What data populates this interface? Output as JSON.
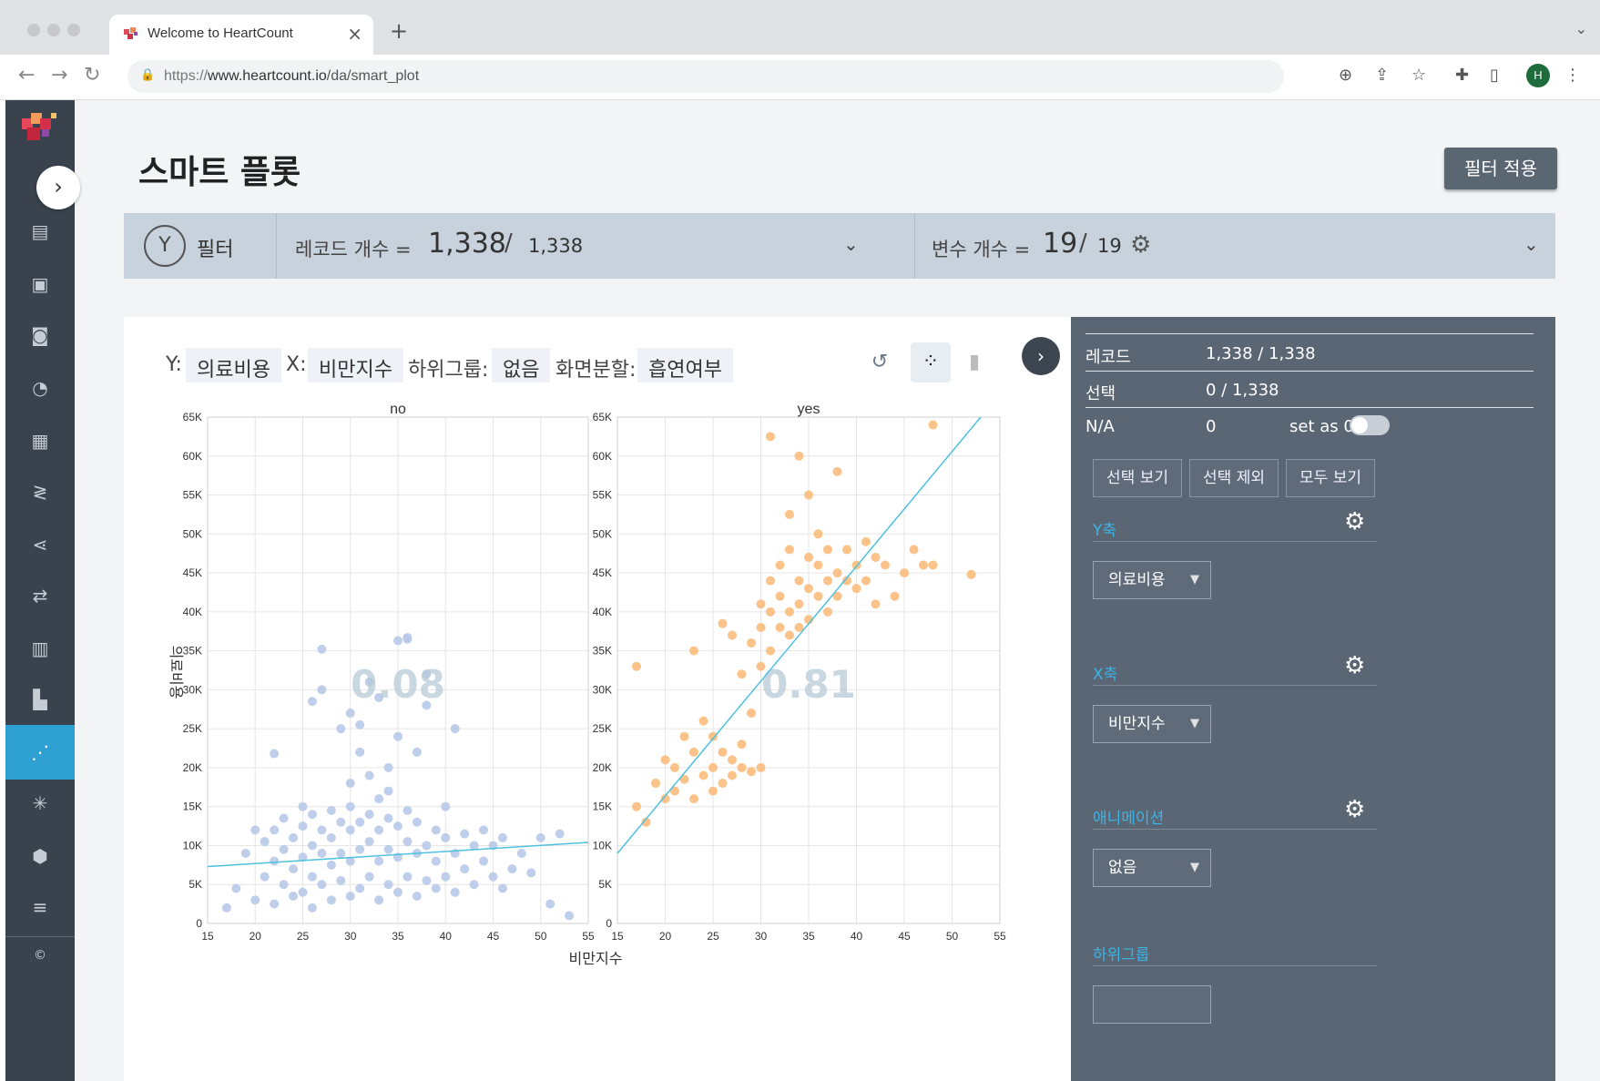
{
  "browser": {
    "tab_title": "Welcome to HeartCount",
    "new_tab": "+",
    "url_scheme": "https://",
    "url_host": "www.heartcount.io",
    "url_path": "/da/smart_plot",
    "profile_initial": "H"
  },
  "header": {
    "title": "스마트 플롯",
    "apply_button": "필터 적용"
  },
  "filterbar": {
    "filter_label": "필터",
    "record_label": "레코드 개수 =",
    "record_count": "1,338",
    "record_total": "1,338",
    "variable_label": "변수 개수 =",
    "variable_count": "19",
    "variable_total": "19",
    "slash": "/"
  },
  "axes_bar": {
    "y_key": "Y:",
    "y_value": "의료비용",
    "x_key": "X:",
    "x_value": "비만지수",
    "subgroup_key": "하위그룹:",
    "subgroup_value": "없음",
    "split_key": "화면분할:",
    "split_value": "흡연여부"
  },
  "panel": {
    "rows": [
      {
        "key": "레코드",
        "value": "1,338 / 1,338"
      },
      {
        "key": "선택",
        "value": "0 / 1,338"
      },
      {
        "key": "N/A",
        "value": "0",
        "setas": "set as 0"
      }
    ],
    "buttons": [
      "선택 보기",
      "선택 제외",
      "모두 보기"
    ],
    "sections": [
      {
        "title": "Y축",
        "value": "의료비용"
      },
      {
        "title": "X축",
        "value": "비만지수"
      },
      {
        "title": "애니메이션",
        "value": "없음"
      },
      {
        "title": "하위그룹",
        "value": ""
      }
    ]
  },
  "colors": {
    "no_points": "#b8c9e8",
    "yes_points": "#fbbb7c",
    "trend_line": "#4fc1e0",
    "panel_bg": "#5a6674",
    "sidebar_bg": "#39424d",
    "accent": "#2fa0d2"
  },
  "chart_data": {
    "type": "scatter",
    "xlabel": "비만지수",
    "ylabel": "의료비용",
    "xlim": [
      15,
      55
    ],
    "ylim": [
      0,
      65000
    ],
    "x_ticks": [
      "15",
      "20",
      "25",
      "30",
      "35",
      "40",
      "45",
      "50",
      "55"
    ],
    "y_ticks": [
      "0",
      "5K",
      "10K",
      "15K",
      "20K",
      "25K",
      "30K",
      "35K",
      "40K",
      "45K",
      "50K",
      "55K",
      "60K",
      "65K"
    ],
    "panels": [
      {
        "name": "no",
        "correlation": "0.08",
        "trend": [
          [
            15,
            7300
          ],
          [
            55,
            10400
          ]
        ],
        "points": [
          [
            18,
            4500
          ],
          [
            19,
            9000
          ],
          [
            20,
            12000
          ],
          [
            20,
            3000
          ],
          [
            21,
            6000
          ],
          [
            21,
            10500
          ],
          [
            22,
            2500
          ],
          [
            22,
            8000
          ],
          [
            22,
            12000
          ],
          [
            23,
            5000
          ],
          [
            23,
            9500
          ],
          [
            23,
            13500
          ],
          [
            24,
            3500
          ],
          [
            24,
            7000
          ],
          [
            24,
            11000
          ],
          [
            25,
            4000
          ],
          [
            25,
            8500
          ],
          [
            25,
            12500
          ],
          [
            25,
            15000
          ],
          [
            26,
            2000
          ],
          [
            26,
            6000
          ],
          [
            26,
            10000
          ],
          [
            26,
            14000
          ],
          [
            27,
            5000
          ],
          [
            27,
            9000
          ],
          [
            27,
            12000
          ],
          [
            27,
            30000
          ],
          [
            28,
            3000
          ],
          [
            28,
            7500
          ],
          [
            28,
            11000
          ],
          [
            28,
            14500
          ],
          [
            29,
            5500
          ],
          [
            29,
            9000
          ],
          [
            29,
            13000
          ],
          [
            29,
            25000
          ],
          [
            30,
            3500
          ],
          [
            30,
            8000
          ],
          [
            30,
            12000
          ],
          [
            30,
            15000
          ],
          [
            30,
            27000
          ],
          [
            31,
            4500
          ],
          [
            31,
            9500
          ],
          [
            31,
            13000
          ],
          [
            31,
            22000
          ],
          [
            32,
            6000
          ],
          [
            32,
            10500
          ],
          [
            32,
            14000
          ],
          [
            32,
            19000
          ],
          [
            33,
            3000
          ],
          [
            33,
            8000
          ],
          [
            33,
            12000
          ],
          [
            33,
            16000
          ],
          [
            33,
            29000
          ],
          [
            34,
            5000
          ],
          [
            34,
            9500
          ],
          [
            34,
            13500
          ],
          [
            34,
            20000
          ],
          [
            35,
            4000
          ],
          [
            35,
            8500
          ],
          [
            35,
            12500
          ],
          [
            35,
            24000
          ],
          [
            36,
            6000
          ],
          [
            36,
            10500
          ],
          [
            36,
            14500
          ],
          [
            36,
            36500
          ],
          [
            37,
            3500
          ],
          [
            37,
            9000
          ],
          [
            37,
            13000
          ],
          [
            37,
            22000
          ],
          [
            38,
            5500
          ],
          [
            38,
            10000
          ],
          [
            38,
            28000
          ],
          [
            39,
            4500
          ],
          [
            39,
            8000
          ],
          [
            39,
            12000
          ],
          [
            40,
            6000
          ],
          [
            40,
            11000
          ],
          [
            40,
            15000
          ],
          [
            41,
            4000
          ],
          [
            41,
            9000
          ],
          [
            41,
            25000
          ],
          [
            42,
            7000
          ],
          [
            42,
            11500
          ],
          [
            43,
            5000
          ],
          [
            43,
            10000
          ],
          [
            44,
            8000
          ],
          [
            44,
            12000
          ],
          [
            45,
            6000
          ],
          [
            45,
            10000
          ],
          [
            46,
            4500
          ],
          [
            46,
            11000
          ],
          [
            47,
            7000
          ],
          [
            48,
            9000
          ],
          [
            49,
            6500
          ],
          [
            50,
            11000
          ],
          [
            51,
            2500
          ],
          [
            52,
            11500
          ],
          [
            53,
            1000
          ],
          [
            27,
            35200
          ],
          [
            35,
            36300
          ],
          [
            36,
            36700
          ],
          [
            22,
            21800
          ],
          [
            17,
            2000
          ],
          [
            26,
            28500
          ],
          [
            30,
            18000
          ],
          [
            32,
            31000
          ],
          [
            38,
            32000
          ],
          [
            31,
            25500
          ],
          [
            34,
            17000
          ]
        ]
      },
      {
        "name": "yes",
        "correlation": "0.81",
        "trend": [
          [
            15,
            9000
          ],
          [
            53,
            65000
          ]
        ],
        "points": [
          [
            17,
            33000
          ],
          [
            17,
            15000
          ],
          [
            18,
            13000
          ],
          [
            19,
            18000
          ],
          [
            20,
            16000
          ],
          [
            20,
            21000
          ],
          [
            21,
            20000
          ],
          [
            21,
            17000
          ],
          [
            22,
            18500
          ],
          [
            22,
            24000
          ],
          [
            23,
            35000
          ],
          [
            23,
            22000
          ],
          [
            23,
            16000
          ],
          [
            24,
            26000
          ],
          [
            24,
            19000
          ],
          [
            25,
            24000
          ],
          [
            25,
            20000
          ],
          [
            25,
            17000
          ],
          [
            26,
            22000
          ],
          [
            26,
            18000
          ],
          [
            26,
            38500
          ],
          [
            27,
            21000
          ],
          [
            27,
            19000
          ],
          [
            27,
            37000
          ],
          [
            28,
            23000
          ],
          [
            28,
            20000
          ],
          [
            28,
            32000
          ],
          [
            29,
            19500
          ],
          [
            29,
            27000
          ],
          [
            29,
            36000
          ],
          [
            30,
            20000
          ],
          [
            30,
            33000
          ],
          [
            30,
            38000
          ],
          [
            30,
            41000
          ],
          [
            31,
            35000
          ],
          [
            31,
            40000
          ],
          [
            31,
            44000
          ],
          [
            31,
            62500
          ],
          [
            32,
            38000
          ],
          [
            32,
            42000
          ],
          [
            32,
            46000
          ],
          [
            33,
            40000
          ],
          [
            33,
            37000
          ],
          [
            33,
            48000
          ],
          [
            33,
            52500
          ],
          [
            34,
            41000
          ],
          [
            34,
            44000
          ],
          [
            34,
            38000
          ],
          [
            34,
            60000
          ],
          [
            35,
            43000
          ],
          [
            35,
            39000
          ],
          [
            35,
            47000
          ],
          [
            35,
            55000
          ],
          [
            36,
            42000
          ],
          [
            36,
            46000
          ],
          [
            36,
            50000
          ],
          [
            37,
            40000
          ],
          [
            37,
            44000
          ],
          [
            37,
            48000
          ],
          [
            38,
            45000
          ],
          [
            38,
            42000
          ],
          [
            38,
            58000
          ],
          [
            39,
            44000
          ],
          [
            39,
            48000
          ],
          [
            40,
            46000
          ],
          [
            40,
            43000
          ],
          [
            41,
            49000
          ],
          [
            41,
            44000
          ],
          [
            42,
            47000
          ],
          [
            42,
            41000
          ],
          [
            43,
            46000
          ],
          [
            44,
            42000
          ],
          [
            45,
            45000
          ],
          [
            46,
            48000
          ],
          [
            47,
            46000
          ],
          [
            48,
            46000
          ],
          [
            48,
            64000
          ],
          [
            52,
            44800
          ]
        ]
      }
    ]
  }
}
